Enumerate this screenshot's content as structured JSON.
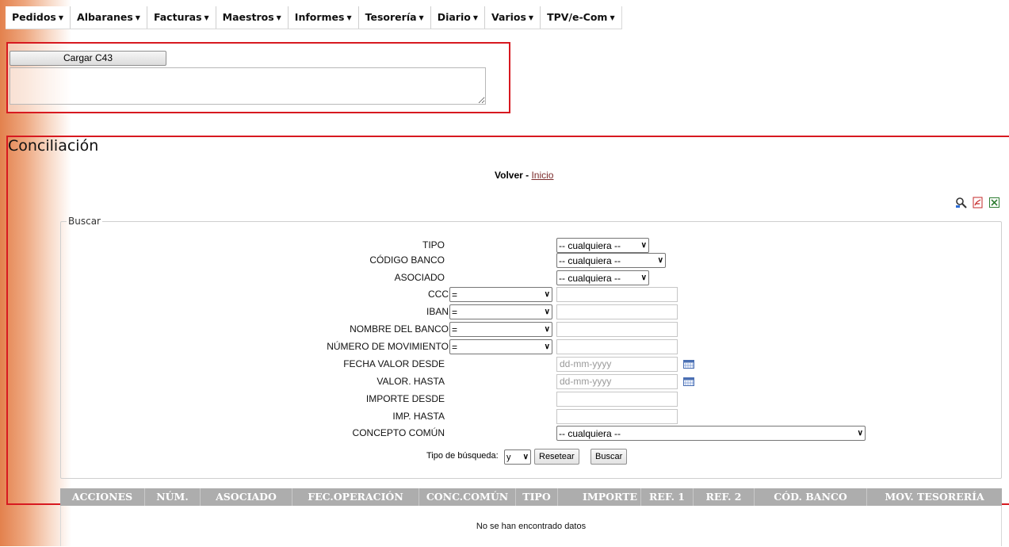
{
  "menu": [
    {
      "label": "Pedidos"
    },
    {
      "label": "Albaranes"
    },
    {
      "label": "Facturas"
    },
    {
      "label": "Maestros"
    },
    {
      "label": "Informes"
    },
    {
      "label": "Tesorería"
    },
    {
      "label": "Diario"
    },
    {
      "label": "Varios"
    },
    {
      "label": "TPV/e-Com"
    }
  ],
  "upload": {
    "button_label": "Cargar C43",
    "textarea_value": ""
  },
  "page": {
    "title": "Conciliación",
    "back_label": "Volver",
    "separator": " - ",
    "home_link": "Inicio"
  },
  "search": {
    "legend": "Buscar",
    "fields": {
      "tipo": {
        "label": "TIPO",
        "value": "-- cualquiera --"
      },
      "codigo_banco": {
        "label": "CÓDIGO BANCO",
        "value": "-- cualquiera --"
      },
      "asociado": {
        "label": "ASOCIADO",
        "value": "-- cualquiera --"
      },
      "ccc": {
        "label": "CCC",
        "operator": "=",
        "value": ""
      },
      "iban": {
        "label": "IBAN",
        "operator": "=",
        "value": ""
      },
      "nombre_banco": {
        "label": "NOMBRE DEL BANCO",
        "operator": "=",
        "value": ""
      },
      "num_movimiento": {
        "label": "NÚMERO DE MOVIMIENTO",
        "operator": "=",
        "value": ""
      },
      "fecha_valor_desde": {
        "label": "FECHA VALOR DESDE",
        "placeholder": "dd-mm-yyyy"
      },
      "valor_hasta": {
        "label": "VALOR. HASTA",
        "placeholder": "dd-mm-yyyy"
      },
      "importe_desde": {
        "label": "IMPORTE DESDE",
        "value": ""
      },
      "imp_hasta": {
        "label": "IMP. HASTA",
        "value": ""
      },
      "concepto_comun": {
        "label": "CONCEPTO COMÚN",
        "value": "-- cualquiera --"
      }
    },
    "search_type_label": "Tipo de búsqueda:",
    "search_type_value": "y",
    "reset_label": "Resetear",
    "search_label": "Buscar"
  },
  "results": {
    "columns": [
      "ACCIONES",
      "NÚM.",
      "ASOCIADO",
      "FEC.OPERACIÓN",
      "CONC.COMÚN",
      "TIPO",
      "IMPORTE",
      "REF. 1",
      "REF. 2",
      "CÓD. BANCO",
      "MOV. TESORERÍA"
    ],
    "empty_message": "No se han encontrado datos"
  },
  "toolbar_icons": [
    "search-zoom-icon",
    "pdf-icon",
    "excel-icon"
  ],
  "colors": {
    "highlight_border": "#d71920",
    "header_bg": "#adadad",
    "link": "#7a2a2a"
  }
}
